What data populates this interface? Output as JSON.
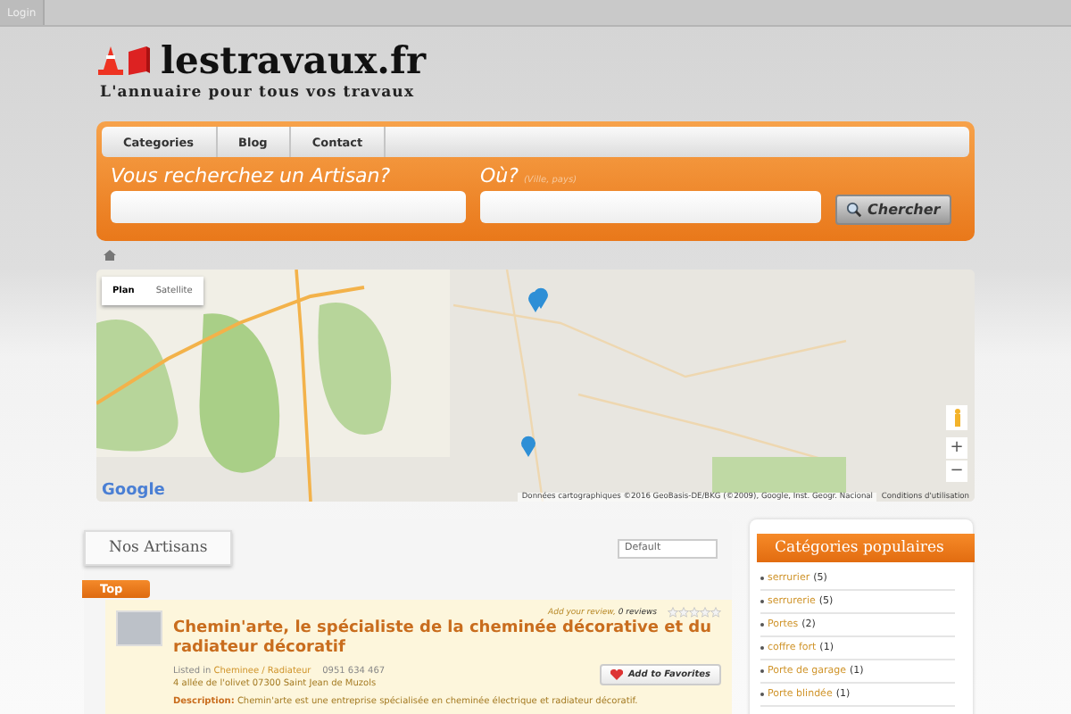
{
  "top_bar": {
    "login": "Login"
  },
  "logo": {
    "name": "lestravaux.fr",
    "tagline": "L'annuaire pour tous vos travaux"
  },
  "nav": [
    {
      "label": "Categories"
    },
    {
      "label": "Blog"
    },
    {
      "label": "Contact"
    }
  ],
  "search": {
    "what_label": "Vous recherchez un Artisan?",
    "where_label": "Où?",
    "where_hint": "(Ville, pays)",
    "button": "Chercher"
  },
  "map": {
    "map_type": [
      {
        "label": "Plan",
        "selected": true
      },
      {
        "label": "Satellite",
        "selected": false
      }
    ],
    "google": "Google",
    "attribution": "Données cartographiques ©2016 GeoBasis-DE/BKG (©2009), Google, Inst. Geogr. Nacional",
    "terms": "Conditions d'utilisation",
    "zoom_in": "+",
    "zoom_out": "−"
  },
  "artisans": {
    "title": "Nos Artisans",
    "sort": "Default",
    "ribbon": "Top",
    "listing": {
      "add_review": "Add your review,",
      "reviews": "0 reviews",
      "stars": 0,
      "name": "Chemin'arte, le spécialiste de la cheminée décorative et du radiateur décoratif",
      "listed_in": "Listed in",
      "category": "Cheminee / Radiateur",
      "phone": "0951 634 467",
      "address": "4 allée de l'olivet 07300 Saint Jean de Muzols",
      "favorites": "Add to Favorites",
      "description_label": "Description:",
      "description": "Chemin'arte est une entreprise spécialisée en cheminée électrique et radiateur décoratif."
    }
  },
  "categories": {
    "title": "Catégories populaires",
    "items": [
      {
        "name": "serrurier",
        "count": "(5)"
      },
      {
        "name": "serrurerie",
        "count": "(5)"
      },
      {
        "name": "Portes",
        "count": "(2)"
      },
      {
        "name": "coffre fort",
        "count": "(1)"
      },
      {
        "name": "Porte de garage",
        "count": "(1)"
      },
      {
        "name": "Porte blindée",
        "count": "(1)"
      }
    ]
  }
}
